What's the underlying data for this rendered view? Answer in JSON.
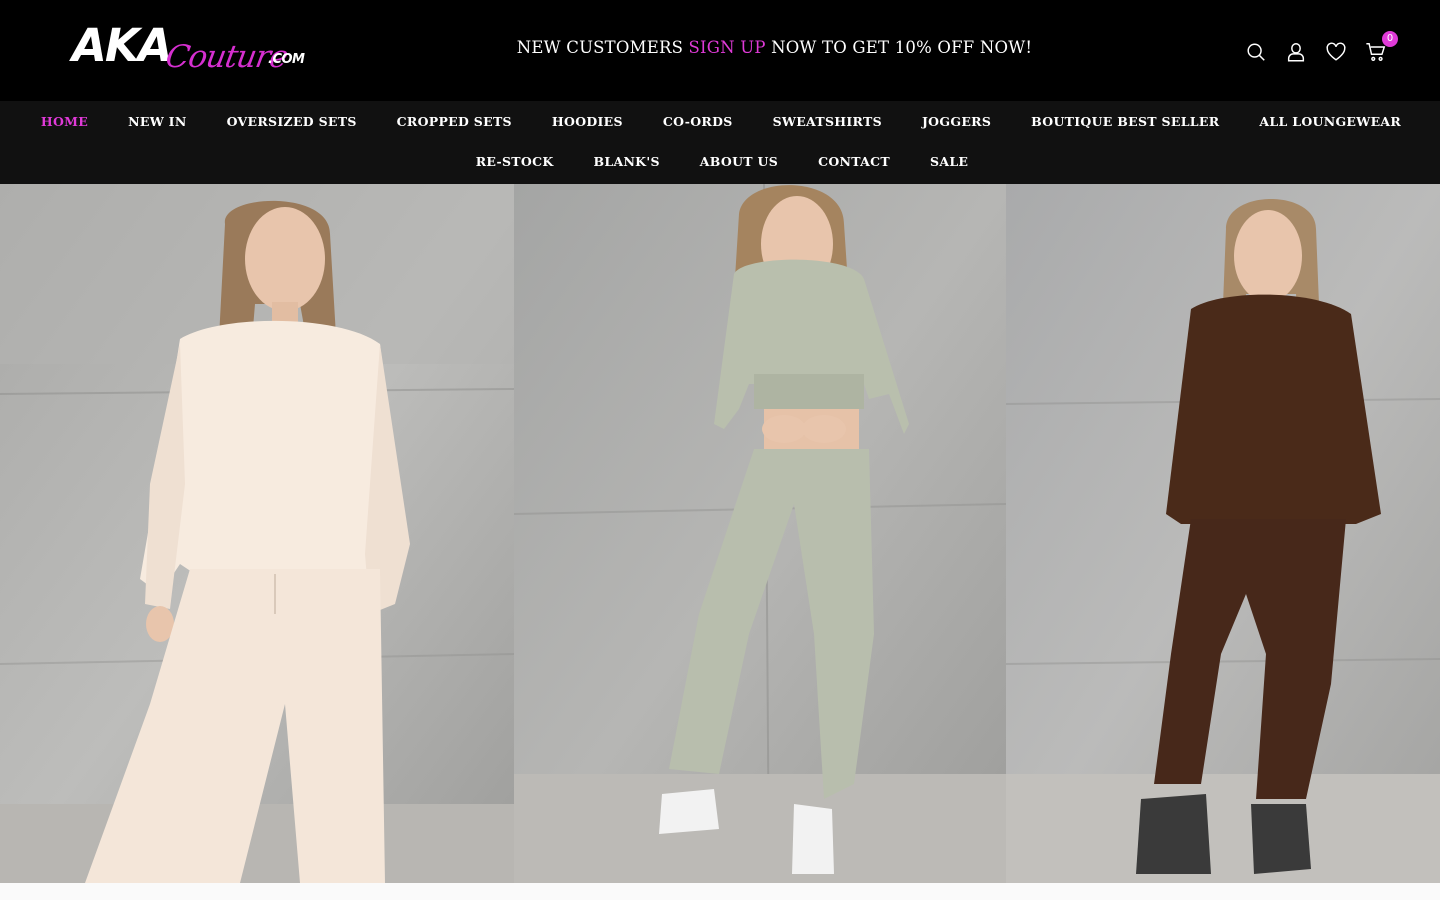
{
  "header": {
    "logo": {
      "main": "AKA",
      "script": "Couture",
      "suffix": ".COM"
    },
    "promo": {
      "before": "NEW CUSTOMERS ",
      "link": "SIGN UP",
      "after": " NOW TO GET 10% OFF NOW!"
    },
    "icons": [
      "search-icon",
      "account-icon",
      "wishlist-icon",
      "cart-icon"
    ],
    "cart_count": "0",
    "colors": {
      "background": "#000000",
      "accent": "#e03ad8"
    }
  },
  "nav": {
    "row1": [
      {
        "label": "HOME",
        "active": true
      },
      {
        "label": "NEW IN"
      },
      {
        "label": "OVERSIZED SETS"
      },
      {
        "label": "CROPPED SETS"
      },
      {
        "label": "HOODIES"
      },
      {
        "label": "CO-ORDS"
      },
      {
        "label": "SWEATSHIRTS"
      },
      {
        "label": "JOGGERS"
      },
      {
        "label": "BOUTIQUE BEST SELLER"
      },
      {
        "label": "ALL LOUNGEWEAR"
      }
    ],
    "row2": [
      {
        "label": "RE-STOCK"
      },
      {
        "label": "BLANK'S"
      },
      {
        "label": "ABOUT US"
      },
      {
        "label": "CONTACT"
      },
      {
        "label": "SALE"
      }
    ]
  },
  "hero": {
    "panels": [
      {
        "outfit": "cream-lounge-set",
        "color": "#f7ebdf"
      },
      {
        "outfit": "sage-cropped-hoodie-set",
        "color": "#b9bfad"
      },
      {
        "outfit": "brown-lounge-set",
        "color": "#4a2a19"
      }
    ]
  }
}
